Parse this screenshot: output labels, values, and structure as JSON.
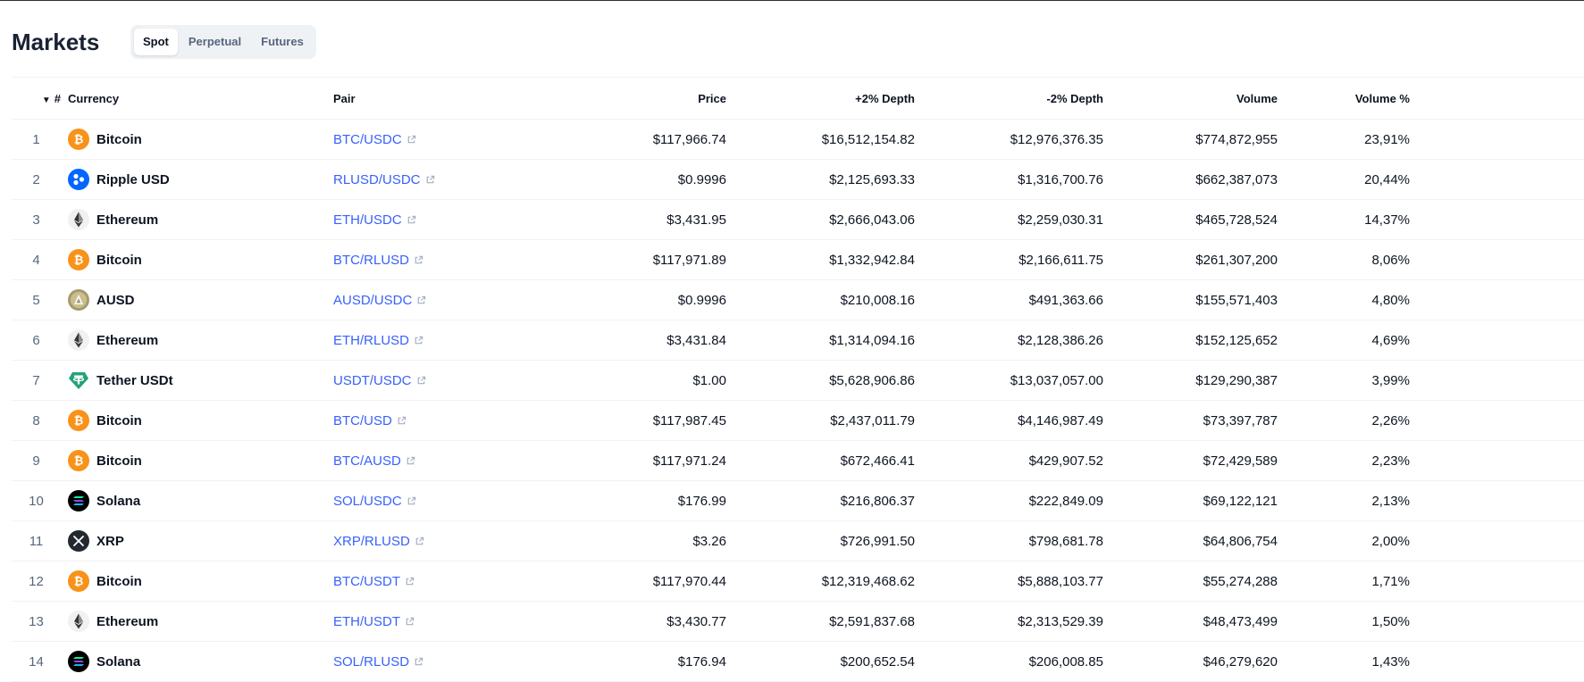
{
  "header": {
    "title": "Markets",
    "tabs": [
      {
        "label": "Spot",
        "active": true
      },
      {
        "label": "Perpetual",
        "active": false
      },
      {
        "label": "Futures",
        "active": false
      }
    ]
  },
  "table": {
    "columns": {
      "rank": "#",
      "currency": "Currency",
      "pair": "Pair",
      "price": "Price",
      "plus_depth": "+2% Depth",
      "minus_depth": "-2% Depth",
      "volume": "Volume",
      "volume_pct": "Volume %"
    },
    "rows": [
      {
        "rank": "1",
        "currency": "Bitcoin",
        "icon": "bitcoin-icon",
        "pair": "BTC/USDC",
        "price": "$117,966.74",
        "plus_depth": "$16,512,154.82",
        "minus_depth": "$12,976,376.35",
        "volume": "$774,872,955",
        "volume_pct": "23,91%"
      },
      {
        "rank": "2",
        "currency": "Ripple USD",
        "icon": "ripple-usd-icon",
        "pair": "RLUSD/USDC",
        "price": "$0.9996",
        "plus_depth": "$2,125,693.33",
        "minus_depth": "$1,316,700.76",
        "volume": "$662,387,073",
        "volume_pct": "20,44%"
      },
      {
        "rank": "3",
        "currency": "Ethereum",
        "icon": "ethereum-icon",
        "pair": "ETH/USDC",
        "price": "$3,431.95",
        "plus_depth": "$2,666,043.06",
        "minus_depth": "$2,259,030.31",
        "volume": "$465,728,524",
        "volume_pct": "14,37%"
      },
      {
        "rank": "4",
        "currency": "Bitcoin",
        "icon": "bitcoin-icon",
        "pair": "BTC/RLUSD",
        "price": "$117,971.89",
        "plus_depth": "$1,332,942.84",
        "minus_depth": "$2,166,611.75",
        "volume": "$261,307,200",
        "volume_pct": "8,06%"
      },
      {
        "rank": "5",
        "currency": "AUSD",
        "icon": "ausd-icon",
        "pair": "AUSD/USDC",
        "price": "$0.9996",
        "plus_depth": "$210,008.16",
        "minus_depth": "$491,363.66",
        "volume": "$155,571,403",
        "volume_pct": "4,80%"
      },
      {
        "rank": "6",
        "currency": "Ethereum",
        "icon": "ethereum-icon",
        "pair": "ETH/RLUSD",
        "price": "$3,431.84",
        "plus_depth": "$1,314,094.16",
        "minus_depth": "$2,128,386.26",
        "volume": "$152,125,652",
        "volume_pct": "4,69%"
      },
      {
        "rank": "7",
        "currency": "Tether USDt",
        "icon": "tether-icon",
        "pair": "USDT/USDC",
        "price": "$1.00",
        "plus_depth": "$5,628,906.86",
        "minus_depth": "$13,037,057.00",
        "volume": "$129,290,387",
        "volume_pct": "3,99%"
      },
      {
        "rank": "8",
        "currency": "Bitcoin",
        "icon": "bitcoin-icon",
        "pair": "BTC/USD",
        "price": "$117,987.45",
        "plus_depth": "$2,437,011.79",
        "minus_depth": "$4,146,987.49",
        "volume": "$73,397,787",
        "volume_pct": "2,26%"
      },
      {
        "rank": "9",
        "currency": "Bitcoin",
        "icon": "bitcoin-icon",
        "pair": "BTC/AUSD",
        "price": "$117,971.24",
        "plus_depth": "$672,466.41",
        "minus_depth": "$429,907.52",
        "volume": "$72,429,589",
        "volume_pct": "2,23%"
      },
      {
        "rank": "10",
        "currency": "Solana",
        "icon": "solana-icon",
        "pair": "SOL/USDC",
        "price": "$176.99",
        "plus_depth": "$216,806.37",
        "minus_depth": "$222,849.09",
        "volume": "$69,122,121",
        "volume_pct": "2,13%"
      },
      {
        "rank": "11",
        "currency": "XRP",
        "icon": "xrp-icon",
        "pair": "XRP/RLUSD",
        "price": "$3.26",
        "plus_depth": "$726,991.50",
        "minus_depth": "$798,681.78",
        "volume": "$64,806,754",
        "volume_pct": "2,00%"
      },
      {
        "rank": "12",
        "currency": "Bitcoin",
        "icon": "bitcoin-icon",
        "pair": "BTC/USDT",
        "price": "$117,970.44",
        "plus_depth": "$12,319,468.62",
        "minus_depth": "$5,888,103.77",
        "volume": "$55,274,288",
        "volume_pct": "1,71%"
      },
      {
        "rank": "13",
        "currency": "Ethereum",
        "icon": "ethereum-icon",
        "pair": "ETH/USDT",
        "price": "$3,430.77",
        "plus_depth": "$2,591,837.68",
        "minus_depth": "$2,313,529.39",
        "volume": "$48,473,499",
        "volume_pct": "1,50%"
      },
      {
        "rank": "14",
        "currency": "Solana",
        "icon": "solana-icon",
        "pair": "SOL/RLUSD",
        "price": "$176.94",
        "plus_depth": "$200,652.54",
        "minus_depth": "$206,008.85",
        "volume": "$46,279,620",
        "volume_pct": "1,43%"
      }
    ]
  },
  "colors": {
    "link": "#3861fb",
    "bitcoin": "#f7931a",
    "ripple_usd": "#0066ff",
    "tether": "#26a17b",
    "ausd": "#a59a6b"
  }
}
